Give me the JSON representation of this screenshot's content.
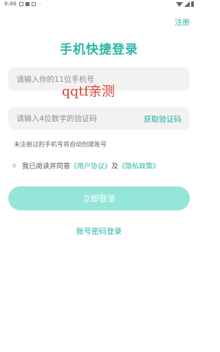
{
  "status_bar": {
    "time": "9:46",
    "dots": "··"
  },
  "header": {
    "register_link": "注册",
    "title": "手机快捷登录"
  },
  "form": {
    "phone_placeholder": "请输入你的11位手机号",
    "code_placeholder": "请输入4位数字的验证码",
    "get_code_label": "获取验证码",
    "hint": "未注册过的手机号将自动创建账号"
  },
  "agreement": {
    "prefix": "我已阅读并同意",
    "user_agreement": "《用户协议》",
    "and": "及",
    "privacy_policy": "《隐私政策》"
  },
  "login_button": "立即登录",
  "password_login_link": "账号密码登录",
  "watermark": "qqtf亲测",
  "colors": {
    "accent": "#27b7a8",
    "button_bg": "#95e6da",
    "field_bg": "#f2f2f2",
    "watermark": "#e23a32"
  }
}
